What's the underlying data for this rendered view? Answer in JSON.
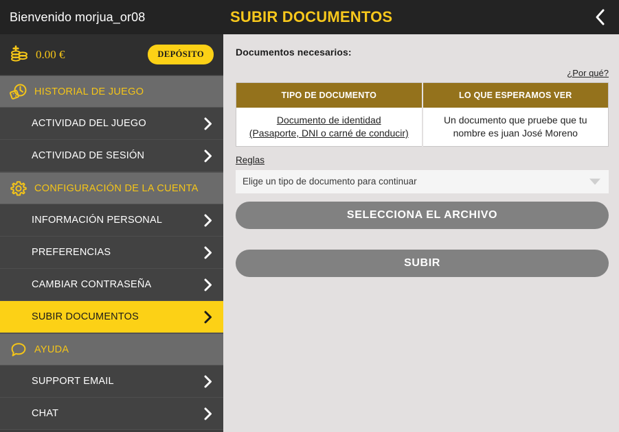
{
  "header": {
    "welcome": "Bienvenido morjua_or08",
    "page_title": "SUBIR DOCUMENTOS",
    "back_icon": "chevron-left-icon"
  },
  "sidebar": {
    "balance": {
      "icon": "coins-stack-plus-icon",
      "amount": "0.00 €",
      "deposit_label": "DEPÓSITO"
    },
    "sections": [
      {
        "icon": "clock-dice-icon",
        "label": "HISTORIAL DE JUEGO",
        "items": [
          {
            "label": "ACTIVIDAD DEL JUEGO",
            "active": false
          },
          {
            "label": "ACTIVIDAD DE SESIÓN",
            "active": false
          }
        ]
      },
      {
        "icon": "gear-icon",
        "label": "CONFIGURACIÓN DE LA CUENTA",
        "items": [
          {
            "label": "INFORMACIÓN PERSONAL",
            "active": false
          },
          {
            "label": "PREFERENCIAS",
            "active": false
          },
          {
            "label": "CAMBIAR CONTRASEÑA",
            "active": false
          },
          {
            "label": "SUBIR DOCUMENTOS",
            "active": true
          }
        ]
      },
      {
        "icon": "chat-bubble-icon",
        "label": "AYUDA",
        "items": [
          {
            "label": "SUPPORT EMAIL",
            "active": false
          },
          {
            "label": "CHAT",
            "active": false
          }
        ]
      }
    ]
  },
  "main": {
    "docs_label": "Documentos necesarios:",
    "why_link": "¿Por qué?",
    "table": {
      "headers": [
        "TIPO DE DOCUMENTO",
        "LO QUE ESPERAMOS VER"
      ],
      "rows": [
        {
          "type_line1": "Documento de identidad",
          "type_line2": "(Pasaporte, DNI o carné de conducir)",
          "expect_line1": "Un documento que pruebe que tu",
          "expect_line2": "nombre es  juan José  Moreno"
        }
      ]
    },
    "rules_link": "Reglas",
    "select_value": "Elige un tipo de documento para continuar",
    "select_file_label": "SELECCIONA EL ARCHIVO",
    "upload_label": "SUBIR"
  },
  "colors": {
    "accent_yellow": "#fcd116",
    "header_dark": "#232323",
    "sidebar_item": "#424242",
    "sidebar_section": "#6b6b6b",
    "table_header_gold": "#94721c",
    "button_gray": "#818181",
    "content_bg": "#e3e0e0"
  }
}
